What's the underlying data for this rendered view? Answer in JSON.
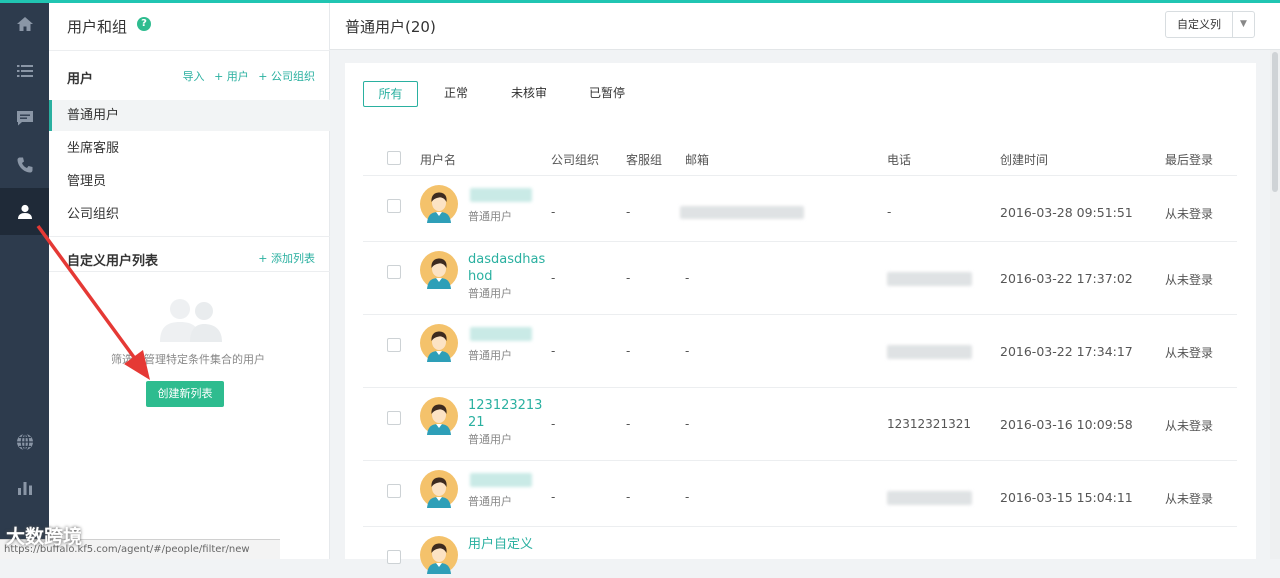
{
  "sidebar_rail": {
    "items": [
      {
        "icon": "home-icon",
        "active": false
      },
      {
        "icon": "list-icon",
        "active": false
      },
      {
        "icon": "chat-icon",
        "active": false
      },
      {
        "icon": "phone-icon",
        "active": false
      },
      {
        "icon": "user-icon",
        "active": true
      },
      {
        "icon": "globe-icon",
        "active": false
      },
      {
        "icon": "chart-icon",
        "active": false
      }
    ]
  },
  "side": {
    "title": "用户和组",
    "help_icon": "?",
    "users_section": {
      "heading": "用户",
      "links": [
        "导入",
        "+ 用户",
        "+ 公司组织"
      ]
    },
    "nav": [
      {
        "label": "普通用户",
        "active": true
      },
      {
        "label": "坐席客服",
        "active": false
      },
      {
        "label": "管理员",
        "active": false
      },
      {
        "label": "公司组织",
        "active": false
      }
    ],
    "custom_section": {
      "heading": "自定义用户列表",
      "add_link": "+ 添加列表"
    },
    "empty_text": "筛选、管理特定条件集合的用户",
    "create_button": "创建新列表"
  },
  "main": {
    "title": "普通用户(20)",
    "columns_button": "自定义列",
    "tabs": [
      {
        "label": "所有",
        "active": true
      },
      {
        "label": "正常",
        "active": false
      },
      {
        "label": "未核审",
        "active": false
      },
      {
        "label": "已暂停",
        "active": false
      }
    ],
    "table_headers": [
      "用户名",
      "公司组织",
      "客服组",
      "邮箱",
      "电话",
      "创建时间",
      "最后登录"
    ],
    "rows": [
      {
        "name": "",
        "role": "普通用户",
        "org": "-",
        "group": "-",
        "email": "",
        "phone": "-",
        "created": "2016-03-28 09:51:51",
        "last_login": "从未登录"
      },
      {
        "name": "dasdasdhashod",
        "role": "普通用户",
        "org": "-",
        "group": "-",
        "email": "-",
        "phone": "",
        "created": "2016-03-22 17:37:02",
        "last_login": "从未登录"
      },
      {
        "name": "",
        "role": "普通用户",
        "org": "-",
        "group": "-",
        "email": "-",
        "phone": "",
        "created": "2016-03-22 17:34:17",
        "last_login": "从未登录"
      },
      {
        "name": "12312321321",
        "role": "普通用户",
        "org": "-",
        "group": "-",
        "email": "-",
        "phone": "12312321321",
        "created": "2016-03-16 10:09:58",
        "last_login": "从未登录"
      },
      {
        "name": "",
        "role": "普通用户",
        "org": "-",
        "group": "-",
        "email": "-",
        "phone": "",
        "created": "2016-03-15 15:04:11",
        "last_login": "从未登录"
      },
      {
        "name": "用户自定义",
        "role": "",
        "org": "",
        "group": "",
        "email": "",
        "phone": "",
        "created": "",
        "last_login": ""
      }
    ]
  },
  "statusbar": {
    "url": "https://buffalo.kf5.com/agent/#/people/filter/new"
  },
  "watermark": {
    "text": "大数跨境"
  },
  "colors": {
    "accent": "#2ab0a0",
    "button": "#2ebc8f",
    "rail": "#2d3b4d",
    "arrow": "#e53935"
  }
}
